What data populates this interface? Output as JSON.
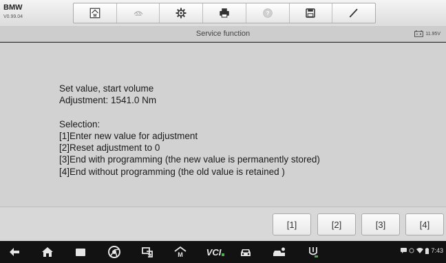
{
  "header": {
    "brand": "BMW",
    "version": "V0.99.04",
    "toolbar_icons": [
      "home-icon",
      "vehicle-swap-icon",
      "gear-icon",
      "printer-icon",
      "help-icon",
      "save-icon",
      "pen-icon"
    ]
  },
  "title_bar": {
    "title": "Service function",
    "voltage": "11.95V"
  },
  "message": {
    "lines": [
      "Set value, start volume",
      "Adjustment: 1541.0 Nm",
      "",
      "Selection:",
      "[1]Enter new value for adjustment",
      "[2]Reset adjustment to 0",
      "[3]End with programming (the new value is permanently stored)",
      "[4]End without programming (the old value is retained )"
    ]
  },
  "buttons": [
    "[1]",
    "[2]",
    "[3]",
    "[4]"
  ],
  "system_bar": {
    "icons": [
      "back-icon",
      "home-icon",
      "recent-apps-icon",
      "chrome-icon",
      "remote-icon",
      "autel-home-icon",
      "vci-icon",
      "car-icon",
      "repair-icon",
      "mic-icon"
    ],
    "vci_label": "VCI",
    "time": "7:43"
  }
}
